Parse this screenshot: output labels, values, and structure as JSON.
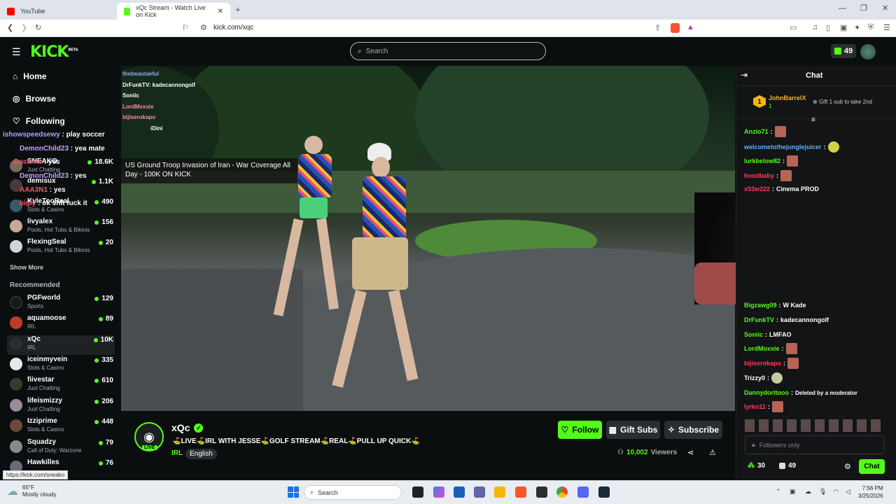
{
  "browser": {
    "tabs": [
      {
        "label": "YouTube",
        "active": false
      },
      {
        "label": "xQc Stream - Watch Live on Kick",
        "active": true
      }
    ],
    "url": "kick.com/xqc",
    "status_url": "https://kick.com/sneako"
  },
  "kick": {
    "logo": "KICK",
    "logo_badge": "BETA",
    "search_placeholder": "Search",
    "kicks_count": "49"
  },
  "nav": {
    "home": "Home",
    "browse": "Browse",
    "following": "Following"
  },
  "following": [
    {
      "name": "SNEAKO",
      "category": "Just Chatting",
      "viewers": "18.6K"
    },
    {
      "name": "demisux",
      "category": "",
      "viewers": "1.1K"
    },
    {
      "name": "KyleTooReal",
      "category": "Slots & Casino",
      "viewers": "490"
    },
    {
      "name": "livyalex",
      "category": "Pools, Hot Tubs & Bikinis",
      "viewers": "156"
    },
    {
      "name": "FlexingSeal",
      "category": "Pools, Hot Tubs & Bikinis",
      "viewers": "20"
    }
  ],
  "show_more": "Show More",
  "recommended_label": "Recommended",
  "recommended": [
    {
      "name": "PGFworld",
      "category": "Sports",
      "viewers": "129"
    },
    {
      "name": "aquamoose",
      "category": "IRL",
      "viewers": "89"
    },
    {
      "name": "xQc",
      "category": "IRL",
      "viewers": "10K"
    },
    {
      "name": "iceinmyvein",
      "category": "Slots & Casino",
      "viewers": "335"
    },
    {
      "name": "fiivestar",
      "category": "Just Chatting",
      "viewers": "610"
    },
    {
      "name": "lifeismizzy",
      "category": "Just Chatting",
      "viewers": "206"
    },
    {
      "name": "Izziprime",
      "category": "Slots & Casino",
      "viewers": "448"
    },
    {
      "name": "Squadzy",
      "category": "Call of Duty: Warzone",
      "viewers": "79"
    },
    {
      "name": "Hawkilles",
      "category": "",
      "viewers": "76"
    }
  ],
  "sim_chat": [
    {
      "user": "ishowspeedsewy",
      "text": "play soccer"
    },
    {
      "user": "DemonChild23",
      "text": "yea mate"
    },
    {
      "user": "Daswow",
      "text": "yes"
    },
    {
      "user": "DemonChild23",
      "text": "yes"
    },
    {
      "user": "AAA3N1",
      "text": "yes"
    },
    {
      "user": "bigly",
      "text": "ok shit fuck it"
    }
  ],
  "video_chat": [
    {
      "user": "thebeautaeful",
      "text": ""
    },
    {
      "user": "DrFunkTV",
      "text": "kadecannongolf"
    },
    {
      "user": "Soniic",
      "text": ""
    },
    {
      "user": "LordMexxie",
      "text": ""
    },
    {
      "user": "bijiserokapo",
      "text": ""
    },
    {
      "user": "iDini",
      "text": ""
    }
  ],
  "video_title_overlay": "US Ground Troop Invasion of Iran - War Coverage All Day - 100K ON KICK",
  "stream": {
    "streamer": "xQc",
    "live": "LIVE",
    "title": "⛳LIVE⛳IRL WITH JESSE⛳GOLF STREAM⛳REAL⛳PULL UP QUICK⛳",
    "category": "IRL",
    "language": "English",
    "viewers": "10,002",
    "viewers_label": "Viewers",
    "follow": "Follow",
    "gift_subs": "Gift Subs",
    "subscribe": "Subscribe"
  },
  "chat": {
    "title": "Chat",
    "pinned_user": "JohnBarrelX",
    "pinned_rank": "1",
    "pinned_count": "1",
    "gift_prompt": "Gift 1 sub to take 2nd",
    "messages": [
      {
        "user": "Anzio71",
        "text": "",
        "color": "#53fc18"
      },
      {
        "user": "welcometothejunglejuicer",
        "text": "",
        "color": "#5db2ff"
      },
      {
        "user": "lurkbelow82",
        "text": "",
        "color": "#53fc18"
      },
      {
        "user": "hoodbaby",
        "text": "",
        "color": "#ff3b5c"
      },
      {
        "user": "x53w222",
        "text": "Cinema PROD",
        "color": "#ff3b5c"
      },
      {
        "user": "Bigzawg09",
        "text": "W Kade",
        "color": "#53fc18"
      },
      {
        "user": "DrFunkTV",
        "text": "kadecannongolf",
        "color": "#53fc18"
      },
      {
        "user": "Soniic",
        "text": "LMFAO",
        "color": "#53fc18"
      },
      {
        "user": "LordMoxxie",
        "text": "",
        "color": "#53fc18"
      },
      {
        "user": "bijiserokapo",
        "text": "",
        "color": "#ff3b5c"
      },
      {
        "user": "Trizzy0",
        "text": "",
        "color": "#fff"
      },
      {
        "user": "Dannydoritooo",
        "text": "Deleted by a moderator",
        "color": "#53fc18"
      },
      {
        "user": "lyrko11",
        "text": "",
        "color": "#ff3b5c"
      }
    ],
    "input_placeholder": "Followers only",
    "points": "30",
    "kicks": "49",
    "send": "Chat"
  },
  "taskbar": {
    "weather_temp": "65°F",
    "weather_desc": "Mostly cloudy",
    "search": "Search",
    "time": "7:56 PM",
    "date": "3/25/2026"
  }
}
